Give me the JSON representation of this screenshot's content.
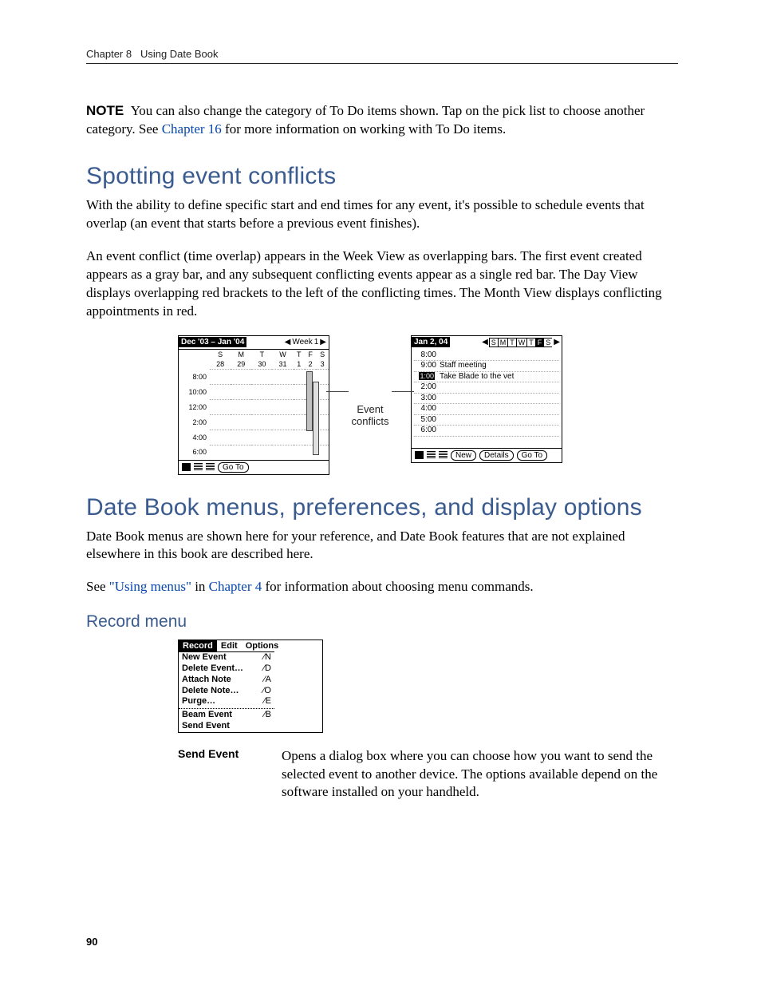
{
  "runningHead": {
    "chapter": "Chapter 8",
    "title": "Using Date Book"
  },
  "pageNumber": "90",
  "note": {
    "label": "NOTE",
    "text_before": "You can also change the category of To Do items shown. Tap on the pick list to choose another category. See ",
    "link": "Chapter 16",
    "text_after": " for more information on working with To Do items."
  },
  "section1": {
    "heading": "Spotting event conflicts",
    "p1": "With the ability to define specific start and end times for any event, it's possible to schedule events that overlap (an event that starts before a previous event finishes).",
    "p2": "An event conflict (time overlap) appears in the Week View as overlapping bars. The first event created appears as a gray bar, and any subsequent conflicting events appear as a single red bar. The Day View displays overlapping red brackets to the left of the conflicting times. The Month View displays conflicting appointments in red."
  },
  "weekView": {
    "title": "Dec '03 – Jan '04",
    "navLabel": "Week",
    "navNum": "1",
    "days": [
      "S",
      "M",
      "T",
      "W",
      "T",
      "F",
      "S"
    ],
    "dates": [
      "28",
      "29",
      "30",
      "31",
      "1",
      "2",
      "3"
    ],
    "times": [
      "8:00",
      "10:00",
      "12:00",
      "2:00",
      "4:00",
      "6:00"
    ],
    "goTo": "Go To"
  },
  "calloutLabel": "Event conflicts",
  "dayView": {
    "date": "Jan 2, 04",
    "dow": [
      "S",
      "M",
      "T",
      "W",
      "T",
      "F",
      "S"
    ],
    "active": "F",
    "rows": [
      {
        "t": "8:00",
        "txt": ""
      },
      {
        "t": "9:00",
        "txt": "Staff meeting"
      },
      {
        "t": "1:00",
        "txt": "Take Blade to the vet",
        "mark": true
      },
      {
        "t": "2:00",
        "txt": ""
      },
      {
        "t": "3:00",
        "txt": ""
      },
      {
        "t": "4:00",
        "txt": ""
      },
      {
        "t": "5:00",
        "txt": ""
      },
      {
        "t": "6:00",
        "txt": ""
      }
    ],
    "new": "New",
    "details": "Details",
    "goTo": "Go To"
  },
  "section2": {
    "heading": "Date Book menus, preferences, and display options",
    "p1": "Date Book menus are shown here for your reference, and Date Book features that are not explained elsewhere in this book are described here.",
    "p2_a": "See ",
    "p2_link1": "\"Using menus\"",
    "p2_b": " in ",
    "p2_link2": "Chapter 4",
    "p2_c": " for information about choosing menu commands."
  },
  "recordMenu": {
    "heading": "Record menu",
    "tabs": [
      "Record",
      "Edit",
      "Options"
    ],
    "items": [
      {
        "l": "New Event",
        "s": "⁄N"
      },
      {
        "l": "Delete Event…",
        "s": "⁄D"
      },
      {
        "l": "Attach Note",
        "s": "⁄A"
      },
      {
        "l": "Delete Note…",
        "s": "⁄O"
      },
      {
        "l": "Purge…",
        "s": "⁄E"
      }
    ],
    "items2": [
      {
        "l": "Beam Event",
        "s": "⁄B"
      },
      {
        "l": "Send Event",
        "s": ""
      }
    ]
  },
  "def": {
    "term": "Send Event",
    "body": "Opens a dialog box where you can choose how you want to send the selected event to another device. The options available depend on the software installed on your handheld."
  }
}
